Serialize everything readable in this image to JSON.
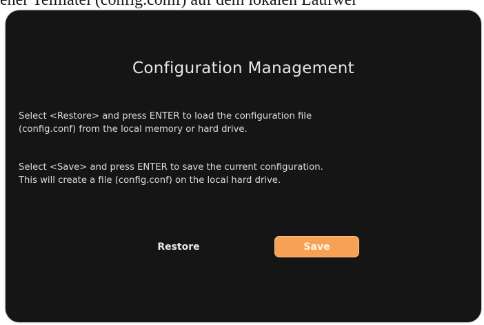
{
  "top_strip": {
    "text": "ener Teilliatei (config.comf) auf dem lokalen Laufwer"
  },
  "dialog": {
    "title": "Configuration Management",
    "paragraphs": [
      {
        "lines": [
          "Select <Restore> and press ENTER to load the configuration file",
          "(config.conf) from the local memory or hard drive."
        ]
      },
      {
        "lines": [
          "Select <Save> and press ENTER to save the current configuration.",
          "This will create a file (config.conf) on the local hard drive."
        ]
      }
    ],
    "buttons": {
      "restore_label": "Restore",
      "save_label": "Save"
    }
  },
  "colors": {
    "dialog_background": "#151515",
    "accent": "#f7a155",
    "text": "#dcdcdc"
  }
}
